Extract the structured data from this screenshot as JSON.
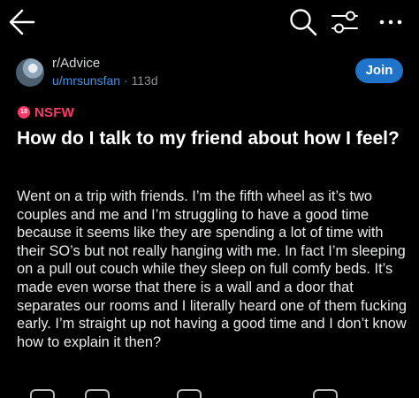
{
  "post": {
    "subreddit": "r/Advice",
    "username": "u/mrsunsfan",
    "age": "113d",
    "separator": "·",
    "join_label": "Join",
    "nsfw_icon_text": "18",
    "nsfw_label": "NSFW",
    "title": "How do I talk to my friend about how I feel?",
    "body": "Went on a trip with friends. I’m the fifth wheel as it’s two couples and me and I’m struggling to have a good time because it seems like they are spending a lot of time with their SO’s but not really hanging with me. In fact I’m sleeping on a pull out couch while they sleep on full comfy beds. It’s made even worse that there is a wall and a door that separates our rooms and I literally heard one of them fucking early. I’m straight up not having a good time and I don’t know how to explain it then?"
  },
  "icons": {
    "back": "arrow-left-icon",
    "search": "search-icon",
    "filter": "sliders-icon",
    "more": "more-horizontal-icon"
  },
  "colors": {
    "background": "#000000",
    "join_button": "#1f74c9",
    "username": "#4a90e2",
    "nsfw": "#ff3a6a"
  }
}
